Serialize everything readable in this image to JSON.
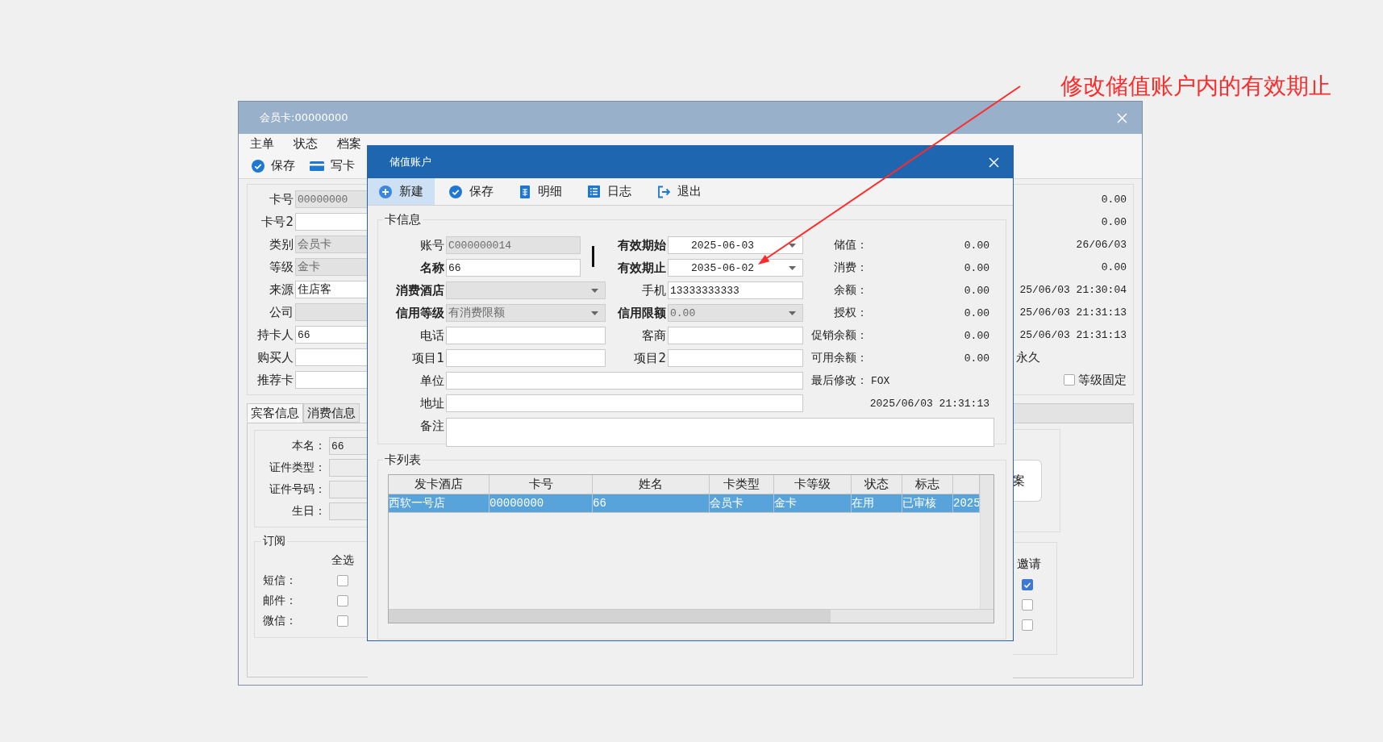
{
  "annotation": {
    "text": "修改储值账户内的有效期止"
  },
  "main_window": {
    "title": "会员卡:00000000",
    "menu": [
      "主单",
      "状态",
      "档案"
    ],
    "toolbar": [
      {
        "label": "保存"
      },
      {
        "label": "写卡"
      }
    ],
    "card_fields": [
      {
        "label": "卡号",
        "value": "00000000",
        "disabled": true
      },
      {
        "label": "卡号2",
        "disabled": false
      },
      {
        "label": "类别",
        "value": "会员卡",
        "disabled": true
      },
      {
        "label": "等级",
        "value": "金卡",
        "disabled": true
      },
      {
        "label": "来源",
        "value": "住店客",
        "disabled": false
      },
      {
        "label": "公司",
        "disabled": true
      },
      {
        "label": "持卡人",
        "value": "66",
        "disabled": false
      },
      {
        "label": "购买人",
        "disabled": false
      },
      {
        "label": "推荐卡",
        "disabled": false
      }
    ],
    "right_values": [
      {
        "value": "0.00",
        "kind": "number"
      },
      {
        "value": "0.00",
        "kind": "number"
      },
      {
        "value": "26/06/03",
        "kind": "number"
      },
      {
        "value": "0.00",
        "kind": "number"
      },
      {
        "value": "25/06/03 21:30:04",
        "kind": "number"
      },
      {
        "value": "25/06/03 21:31:13",
        "kind": "number"
      },
      {
        "value": "25/06/03 21:31:13",
        "kind": "number"
      },
      {
        "value": "永久",
        "kind": "text"
      }
    ],
    "grade_fixed": {
      "label": "等级固定",
      "checked": false
    },
    "tabs": [
      {
        "label": "宾客信息",
        "selected": true
      },
      {
        "label": "消费信息",
        "selected": false
      }
    ],
    "guest_fields": [
      {
        "label": "本名：",
        "value": "66"
      },
      {
        "label": "证件类型："
      },
      {
        "label": "证件号码："
      },
      {
        "label": "生日："
      }
    ],
    "side_button": {
      "label": "案"
    },
    "subscription": {
      "title": "订阅",
      "select_all": "全选",
      "rows": [
        {
          "label": "短信：",
          "checked": false
        },
        {
          "label": "邮件：",
          "checked": false
        },
        {
          "label": "微信：",
          "checked": false
        }
      ],
      "invite": {
        "label": "邀请",
        "rows": [
          {
            "checked": true
          },
          {
            "checked": false
          },
          {
            "checked": false
          }
        ]
      }
    }
  },
  "dialog": {
    "title": "储值账户",
    "toolbar": [
      {
        "label": "新建",
        "selected": true
      },
      {
        "label": "保存",
        "selected": false
      },
      {
        "label": "明细",
        "selected": false
      },
      {
        "label": "日志",
        "selected": false
      },
      {
        "label": "退出",
        "selected": false
      }
    ],
    "card_info": {
      "title": "卡信息",
      "rows": [
        [
          {
            "label": "账号",
            "value": "C000000014",
            "kind": "text",
            "bold": false,
            "disabled": true
          },
          {
            "label": "有效期始",
            "value": "2025-06-03",
            "kind": "date",
            "bold": true,
            "disabled": false
          },
          {
            "label": "储值：",
            "value": "0.00",
            "kind": "reading"
          }
        ],
        [
          {
            "label": "名称",
            "value": "66",
            "kind": "text",
            "bold": true,
            "disabled": false
          },
          {
            "label": "有效期止",
            "value": "2035-06-02",
            "kind": "date",
            "bold": true,
            "disabled": false
          },
          {
            "label": "消费：",
            "value": "0.00",
            "kind": "reading"
          }
        ],
        [
          {
            "label": "消费酒店",
            "kind": "dropdown",
            "bold": true,
            "disabled": true
          },
          {
            "label": "手机",
            "value": "13333333333",
            "kind": "text",
            "bold": false,
            "disabled": false
          },
          {
            "label": "余额：",
            "value": "0.00",
            "kind": "reading"
          }
        ],
        [
          {
            "label": "信用等级",
            "value": "有消费限额",
            "kind": "dropdown",
            "bold": true,
            "disabled": true
          },
          {
            "label": "信用限额",
            "value": "0.00",
            "kind": "dropdown",
            "bold": true,
            "disabled": true
          },
          {
            "label": "授权：",
            "value": "0.00",
            "kind": "reading"
          }
        ],
        [
          {
            "label": "电话",
            "kind": "text",
            "bold": false,
            "disabled": false
          },
          {
            "label": "客商",
            "kind": "text",
            "bold": false,
            "disabled": false
          },
          {
            "label": "促销余额：",
            "value": "0.00",
            "kind": "reading"
          }
        ],
        [
          {
            "label": "项目1",
            "kind": "text",
            "bold": false,
            "disabled": false
          },
          {
            "label": "项目2",
            "kind": "text",
            "bold": false,
            "disabled": false
          },
          {
            "label": "可用余额：",
            "value": "0.00",
            "kind": "reading"
          }
        ],
        [
          {
            "label": "单位",
            "kind": "wide",
            "bold": false,
            "disabled": false
          },
          {
            "label": "最后修改：",
            "value": "FOX",
            "kind": "modifier"
          }
        ],
        [
          {
            "label": "地址",
            "kind": "wide",
            "bold": false,
            "disabled": false
          },
          {
            "value": "2025/06/03 21:31:13",
            "kind": "timestamp"
          }
        ],
        [
          {
            "label": "备注",
            "kind": "note",
            "bold": false,
            "disabled": false
          }
        ]
      ]
    },
    "card_list": {
      "title": "卡列表",
      "columns": [
        "发卡酒店",
        "卡号",
        "姓名",
        "卡类型",
        "卡等级",
        "状态",
        "标志"
      ],
      "rows": [
        {
          "cells": [
            "西软一号店",
            "00000000",
            "66",
            "会员卡",
            "金卡",
            "在用",
            "已审核",
            "2025"
          ],
          "selected": true
        }
      ]
    }
  }
}
